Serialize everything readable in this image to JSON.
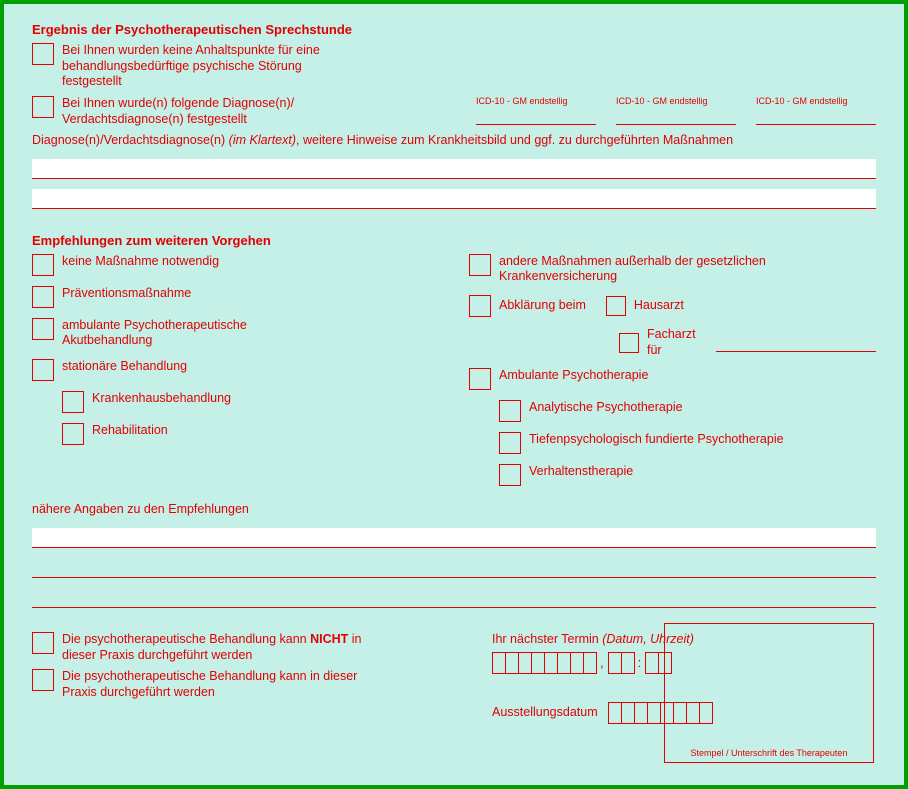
{
  "section1": {
    "heading": "Ergebnis der Psychotherapeutischen Sprechstunde",
    "opt1": "Bei Ihnen wurden keine Anhaltspunkte für eine behandlungsbedürftige psychische Störung festgestellt",
    "opt2": "Bei Ihnen wurde(n) folgende Diagnose(n)/ Verdachtsdiagnose(n) festgestellt",
    "icd_label": "ICD-10 - GM endstellig",
    "diag_prefix": "Diagnose(n)/Verdachtsdiagnose(n) ",
    "diag_italic": "(im Klartext)",
    "diag_suffix": ", weitere Hinweise zum Krankheitsbild und ggf. zu durchgeführten Maßnahmen"
  },
  "section2": {
    "heading": "Empfehlungen zum weiteren Vorgehen",
    "left": {
      "none": "keine Maßnahme notwendig",
      "prevention": "Präventionsmaßnahme",
      "acute": "ambulante Psychotherapeutische Akutbehandlung",
      "stationary": "stationäre Behandlung",
      "hospital": "Krankenhausbehandlung",
      "rehab": "Rehabilitation"
    },
    "right": {
      "other": "andere Maßnahmen außerhalb der gesetzlichen Krankenversicherung",
      "clarify": "Abklärung beim",
      "gp": "Hausarzt",
      "specialist": "Facharzt für",
      "amb_psy": "Ambulante Psychotherapie",
      "analytic": "Analytische Psychotherapie",
      "depth": "Tiefenpsychologisch fundierte Psychotherapie",
      "behavior": "Verhaltenstherapie"
    },
    "details_label": "nähere Angaben zu den Empfehlungen"
  },
  "section3": {
    "cannot_prefix": "Die psychotherapeutische Behandlung kann ",
    "cannot_bold": "NICHT",
    "cannot_suffix": " in dieser Praxis durchgeführt werden",
    "can": "Die psychotherapeutische Behandlung kann in dieser Praxis durchgeführt werden",
    "next_appt_prefix": "Ihr nächster Termin ",
    "next_appt_italic": "(Datum, Uhrzeit)",
    "issue_date": "Ausstellungsdatum",
    "stamp": "Stempel / Unterschrift des Therapeuten"
  }
}
